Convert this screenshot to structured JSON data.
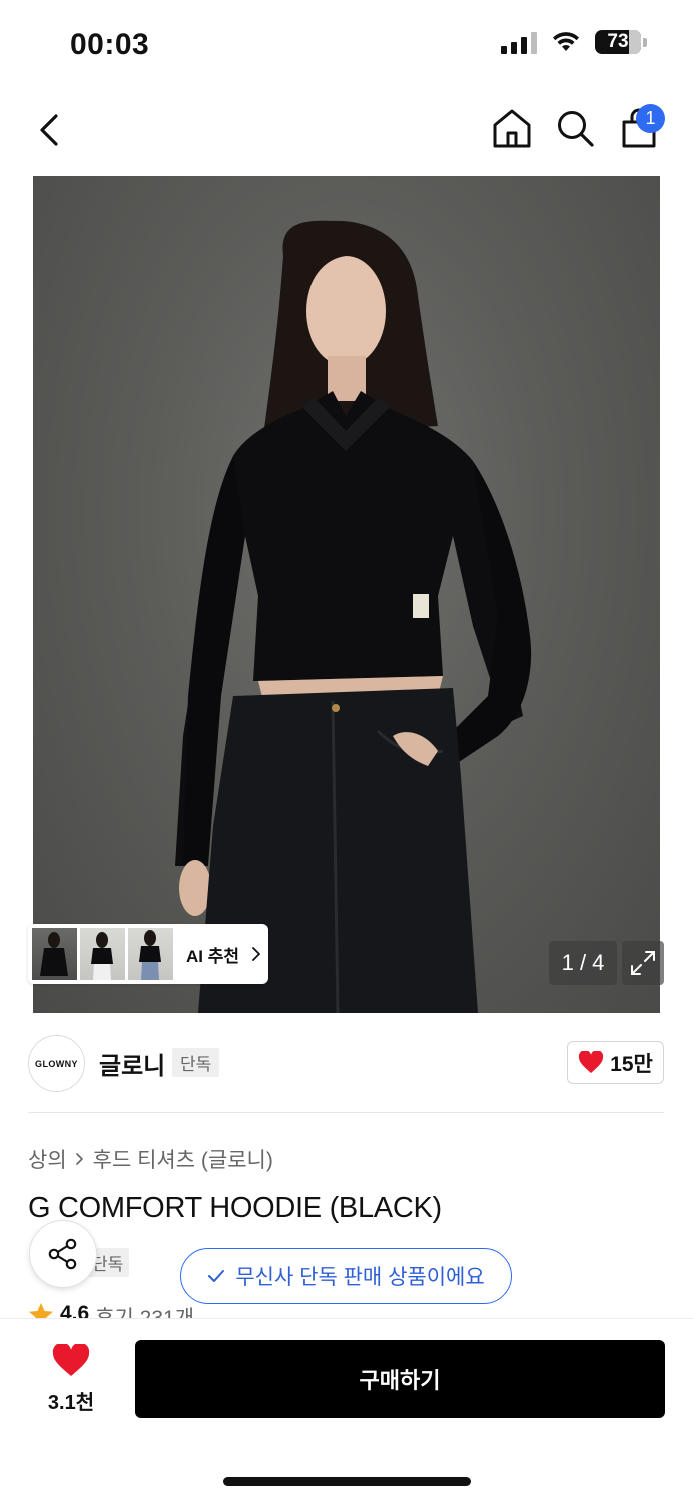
{
  "status_bar": {
    "time": "00:03",
    "battery": "73",
    "battery_fraction": 0.73
  },
  "nav": {
    "cart_count": "1",
    "icons": [
      "back-chevron-icon",
      "home-icon",
      "search-icon",
      "shopping-bag-icon"
    ]
  },
  "gallery": {
    "page_counter": "1 / 4",
    "ai_recommend_label": "AI 추천"
  },
  "brand": {
    "logo_text": "GLOWNY",
    "name": "글로니",
    "tag": "단독",
    "like_count": "15만"
  },
  "product": {
    "breadcrumb": [
      "상의",
      "후드 티셔츠 (글로니)"
    ],
    "title": "G COMFORT HOODIE (BLACK)",
    "exclusive_tag": "단독",
    "exclusive_message": "무신사 단독 판매 상품이에요",
    "rating": "4.6",
    "review_count": "후기 231개"
  },
  "bottom_bar": {
    "likes": "3.1천",
    "buy_label": "구매하기"
  },
  "colors": {
    "accent_blue": "#2f6bf1",
    "heart_red": "#e8192c",
    "star_orange": "#f5a623",
    "buy_black": "#000000"
  }
}
